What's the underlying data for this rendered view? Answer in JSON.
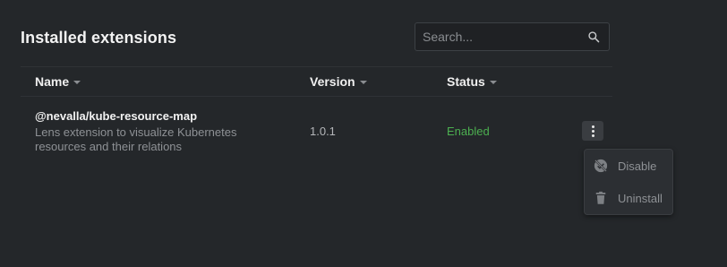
{
  "header": {
    "title": "Installed extensions"
  },
  "search": {
    "placeholder": "Search...",
    "value": "",
    "icon": "search-icon"
  },
  "table": {
    "columns": [
      {
        "label": "Name",
        "sort_icon": "sort-down-icon"
      },
      {
        "label": "Version",
        "sort_icon": "sort-down-icon"
      },
      {
        "label": "Status",
        "sort_icon": "sort-down-icon"
      }
    ],
    "rows": [
      {
        "name": "@nevalla/kube-resource-map",
        "description": "Lens extension to visualize Kubernetes resources and their relations",
        "version": "1.0.1",
        "status": "Enabled",
        "actions_icon": "more-vertical-icon"
      }
    ]
  },
  "menu": {
    "items": [
      {
        "label": "Disable",
        "icon": "disable-icon"
      },
      {
        "label": "Uninstall",
        "icon": "trash-icon"
      }
    ]
  },
  "colors": {
    "background": "#24272a",
    "status_enabled": "#4caf50",
    "menu_background": "#2c2f33"
  }
}
